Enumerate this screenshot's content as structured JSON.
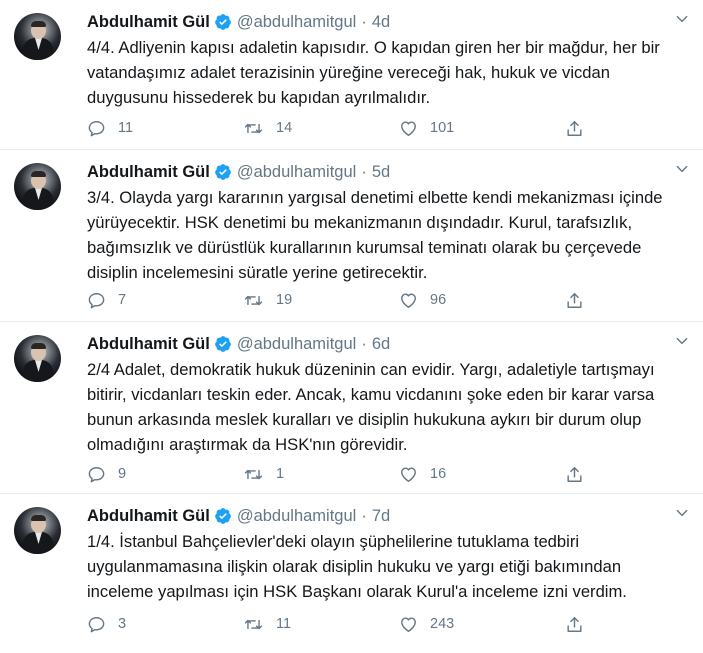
{
  "tweets": [
    {
      "name": "Abdulhamit Gül",
      "handle": "@abdulhamitgul",
      "time": "4d",
      "text": "4/4. Adliyenin kapısı adaletin kapısıdır. O kapıdan giren her bir mağdur, her bir vatandaşımız adalet terazisinin yüreğine vereceği hak, hukuk ve vicdan duygusunu hissederek bu kapıdan ayrılmalıdır.",
      "replies": "11",
      "retweets": "14",
      "likes": "101"
    },
    {
      "name": "Abdulhamit Gül",
      "handle": "@abdulhamitgul",
      "time": "5d",
      "text": "3/4. Olayda yargı kararının yargısal denetimi elbette kendi mekanizması içinde yürüyecektir. HSK denetimi bu mekanizmanın dışındadır. Kurul, tarafsızlık, bağımsızlık ve dürüstlük kurallarının kurumsal teminatı olarak bu çerçevede disiplin incelemesini süratle yerine getirecektir.",
      "replies": "7",
      "retweets": "19",
      "likes": "96"
    },
    {
      "name": "Abdulhamit Gül",
      "handle": "@abdulhamitgul",
      "time": "6d",
      "text": "2/4 Adalet, demokratik hukuk düzeninin can evidir. Yargı, adaletiyle tartışmayı bitirir, vicdanları teskin eder. Ancak, kamu vicdanını şoke eden bir karar varsa bunun arkasında meslek kuralları ve disiplin hukukuna aykırı bir durum olup olmadığını araştırmak da HSK'nın görevidir.",
      "replies": "9",
      "retweets": "1",
      "likes": "16"
    },
    {
      "name": "Abdulhamit Gül",
      "handle": "@abdulhamitgul",
      "time": "7d",
      "text": "1/4. İstanbul Bahçelievler'deki olayın şüphelilerine tutuklama tedbiri uygulanmamasına ilişkin olarak disiplin hukuku ve yargı etiği bakımından inceleme yapılması için HSK Başkanı olarak Kurul'a inceleme izni verdim.",
      "replies": "3",
      "retweets": "11",
      "likes": "243"
    }
  ],
  "separator": "·",
  "colors": {
    "verified": "#1da1f2",
    "secondary": "#657786",
    "text": "#14171a",
    "border": "#e6ecf0"
  },
  "icons": {
    "reply": "reply-icon",
    "retweet": "retweet-icon",
    "like": "heart-icon",
    "share": "share-icon",
    "menu": "chevron-down-icon",
    "badge": "verified-badge-icon"
  }
}
